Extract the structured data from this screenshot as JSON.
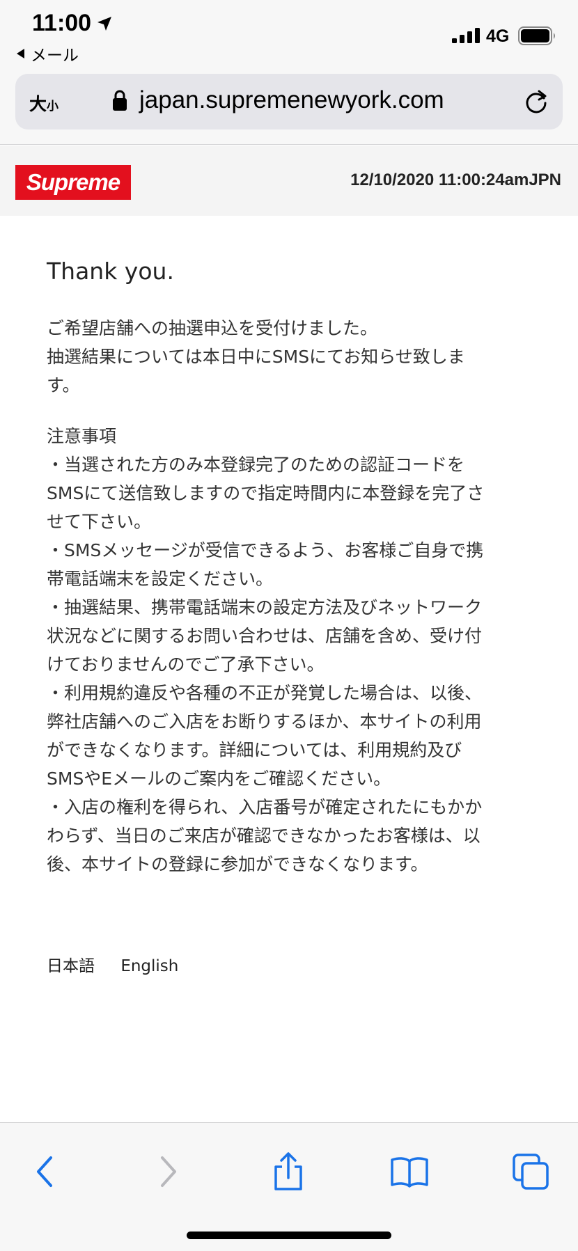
{
  "status_bar": {
    "time": "11:00",
    "back_app": "メール",
    "network": "4G"
  },
  "browser": {
    "text_size": "大",
    "text_size_small": "小",
    "url": "japan.supremenewyork.com"
  },
  "header": {
    "logo_text": "Supreme",
    "brand_color": "#e3101e",
    "datetime": "12/10/2020 11:00:24amJPN"
  },
  "content": {
    "thanks": "Thank you.",
    "intro_lines": [
      "ご希望店舗への抽選申込を受付けました。",
      "抽選結果については本日中にSMSにてお知らせ致しま",
      "す。"
    ],
    "notes_lines": [
      "注意事項",
      "・当選された方のみ本登録完了のための認証コードを",
      "SMSにて送信致しますので指定時間内に本登録を完了さ",
      "せて下さい。",
      "・SMSメッセージが受信できるよう、お客様ご自身で携",
      "帯電話端末を設定ください。",
      "・抽選結果、携帯電話端末の設定方法及びネットワーク",
      "状況などに関するお問い合わせは、店舗を含め、受け付",
      "けておりませんのでご了承下さい。",
      "・利用規約違反や各種の不正が発覚した場合は、以後、",
      "弊社店舗へのご入店をお断りするほか、本サイトの利用",
      "ができなくなります。詳細については、利用規約及び",
      "SMSやEメールのご案内をご確認ください。",
      "・入店の権利を得られ、入店番号が確定されたにもかか",
      "わらず、当日のご来店が確認できなかったお客様は、以",
      "後、本サイトの登録に参加ができなくなります。"
    ]
  },
  "languages": {
    "japanese": "日本語",
    "english": "English"
  },
  "toolbar": {
    "accent_color": "#1a73e8",
    "icons": [
      "back-icon",
      "forward-icon",
      "share-icon",
      "bookmarks-icon",
      "tabs-icon"
    ]
  }
}
